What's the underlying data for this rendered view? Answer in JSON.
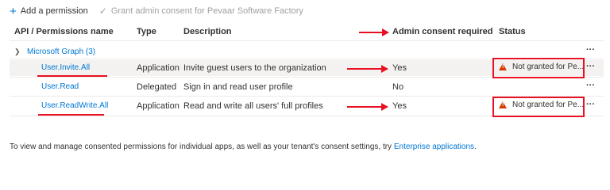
{
  "toolbar": {
    "add_permission_label": "Add a permission",
    "grant_consent_label": "Grant admin consent for Pevaar Software Factory"
  },
  "table": {
    "headers": {
      "permission": "API / Permissions name",
      "type": "Type",
      "description": "Description",
      "admin_consent": "Admin consent required",
      "status": "Status"
    },
    "group": {
      "label": "Microsoft Graph (3)"
    },
    "rows": [
      {
        "name": "User.Invite.All",
        "type": "Application",
        "description": "Invite guest users to the organization",
        "admin_consent": "Yes",
        "status": "Not granted for Pe..."
      },
      {
        "name": "User.Read",
        "type": "Delegated",
        "description": "Sign in and read user profile",
        "admin_consent": "No",
        "status": ""
      },
      {
        "name": "User.ReadWrite.All",
        "type": "Application",
        "description": "Read and write all users' full profiles",
        "admin_consent": "Yes",
        "status": "Not granted for Pe..."
      }
    ],
    "more_glyph": "···"
  },
  "footer": {
    "text": "To view and manage consented permissions for individual apps, as well as your tenant's consent settings, try ",
    "link": "Enterprise applications",
    "suffix": "."
  },
  "colors": {
    "link": "#0078d4",
    "warning": "#d83b01",
    "annotation": "#e81123",
    "row_highlight": "#f3f2f1"
  },
  "icons": {
    "add": "plus-icon",
    "grant": "checkmark-icon",
    "group_toggle": "chevron-down-icon",
    "status": "warning-icon",
    "row_menu": "more-icon"
  }
}
